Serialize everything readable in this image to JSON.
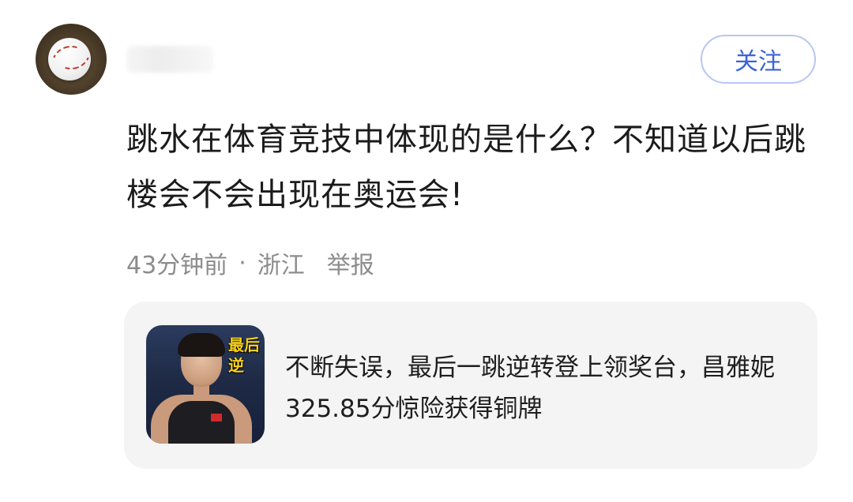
{
  "header": {
    "follow_label": "关注"
  },
  "post": {
    "text": "跳水在体育竞技中体现的是什么？不知道以后跳楼会不会出现在奥运会!",
    "time": "43分钟前",
    "separator": "·",
    "location": "浙江",
    "report_label": "举报"
  },
  "linked_card": {
    "thumbnail_caption": "最后 逆",
    "title": "不断失误，最后一跳逆转登上领奖台，昌雅妮325.85分惊险获得铜牌"
  },
  "colors": {
    "follow_text": "#3a63d6",
    "follow_border": "#b9c6f2",
    "meta_text": "#8c8c8c",
    "card_bg": "#f4f4f4"
  },
  "icons": {
    "avatar": "baseball-avatar"
  }
}
